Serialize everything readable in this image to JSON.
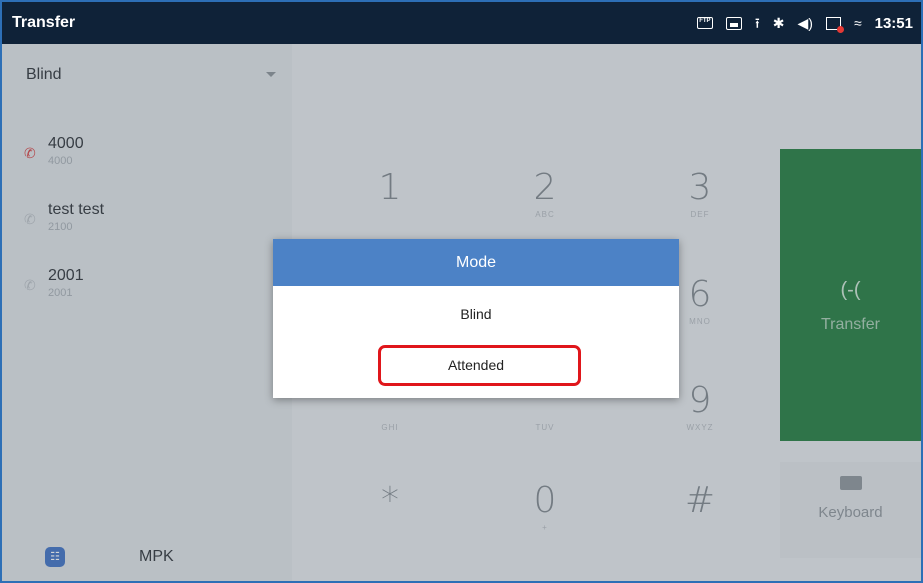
{
  "statusbar": {
    "title": "Transfer",
    "time": "13:51",
    "ftp_label": "FTP",
    "icons": [
      "ftp-icon",
      "image-icon",
      "upload-icon",
      "bluetooth-icon",
      "volume-icon",
      "recording-icon",
      "wifi-icon"
    ]
  },
  "left": {
    "mode_value": "Blind",
    "contacts": [
      {
        "name": "4000",
        "number": "4000",
        "icon": "missed-call-icon",
        "color": "#d63b3b"
      },
      {
        "name": "test test",
        "number": "2100",
        "icon": "call-icon",
        "color": "#b9bec3"
      },
      {
        "name": "2001",
        "number": "2001",
        "icon": "call-icon",
        "color": "#b9bec3"
      }
    ],
    "tabs": {
      "mpk_label": "MPK"
    }
  },
  "dialpad": {
    "keys": [
      {
        "digit": "1",
        "letters": ""
      },
      {
        "digit": "2",
        "letters": "ABC"
      },
      {
        "digit": "3",
        "letters": "DEF"
      },
      {
        "digit": "6",
        "letters": "MNO"
      },
      {
        "digit": "9",
        "letters": "WXYZ"
      },
      {
        "digit": "*",
        "letters": ""
      },
      {
        "digit": "0",
        "letters": "+"
      },
      {
        "digit": "#",
        "letters": ""
      }
    ],
    "hidden_letters": {
      "ghi": "GHI",
      "tuv": "TUV"
    },
    "transfer_label": "Transfer",
    "keyboard_label": "Keyboard"
  },
  "modal": {
    "title": "Mode",
    "options": [
      "Blind",
      "Attended"
    ]
  },
  "colors": {
    "statusbar_bg": "#0f2238",
    "modal_header": "#4c82c6",
    "transfer_green": "#1f7a3b",
    "highlight_red": "#e0161b"
  }
}
